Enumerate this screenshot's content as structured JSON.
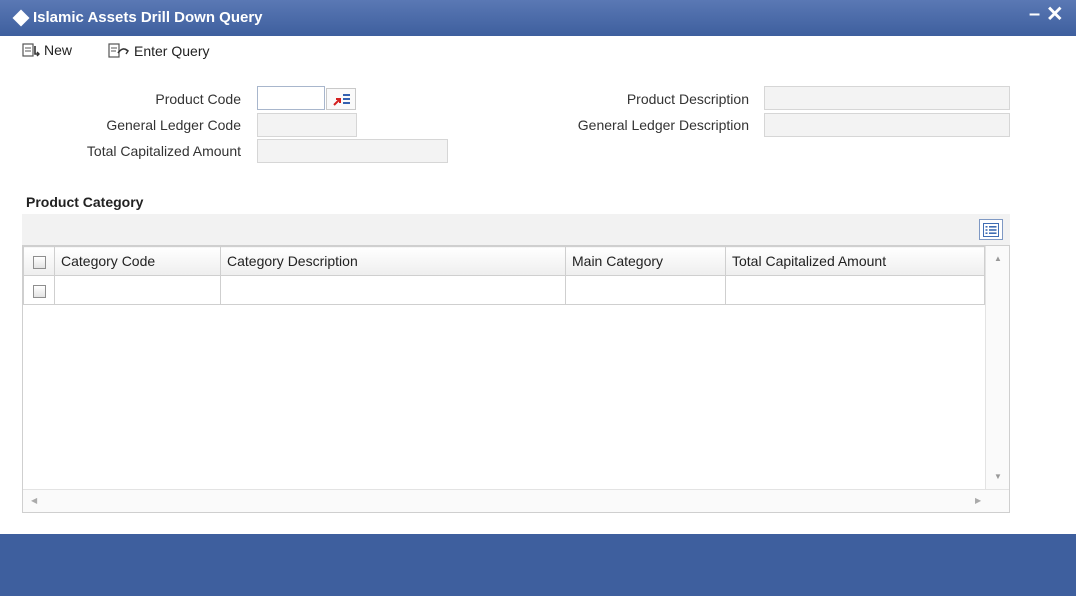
{
  "window": {
    "title": "Islamic Assets Drill Down Query",
    "minimize_label": "–",
    "close_label": "✕"
  },
  "toolbar": {
    "new_label": "New",
    "enter_query_label": "Enter Query"
  },
  "form": {
    "product_code_label": "Product Code",
    "product_code_value": "",
    "general_ledger_code_label": "General Ledger Code",
    "general_ledger_code_value": "",
    "total_capitalized_amount_label": "Total Capitalized Amount",
    "total_capitalized_amount_value": "",
    "product_description_label": "Product Description",
    "product_description_value": "",
    "general_ledger_description_label": "General Ledger Description",
    "general_ledger_description_value": ""
  },
  "product_category": {
    "section_title": "Product Category",
    "columns": [
      "Category Code",
      "Category Description",
      "Main Category",
      "Total Capitalized Amount"
    ],
    "rows": [
      [
        "",
        "",
        "",
        ""
      ]
    ]
  },
  "icons": {
    "window": "diamond-icon",
    "new": "new-record-icon",
    "enter_query": "enter-query-icon",
    "lov": "list-of-values-icon",
    "grid_settings": "grid-columns-icon"
  },
  "colors": {
    "titlebar": "#4a6aa8",
    "bottom_bar": "#3e5f9e",
    "readonly_field": "#f3f3f3"
  }
}
